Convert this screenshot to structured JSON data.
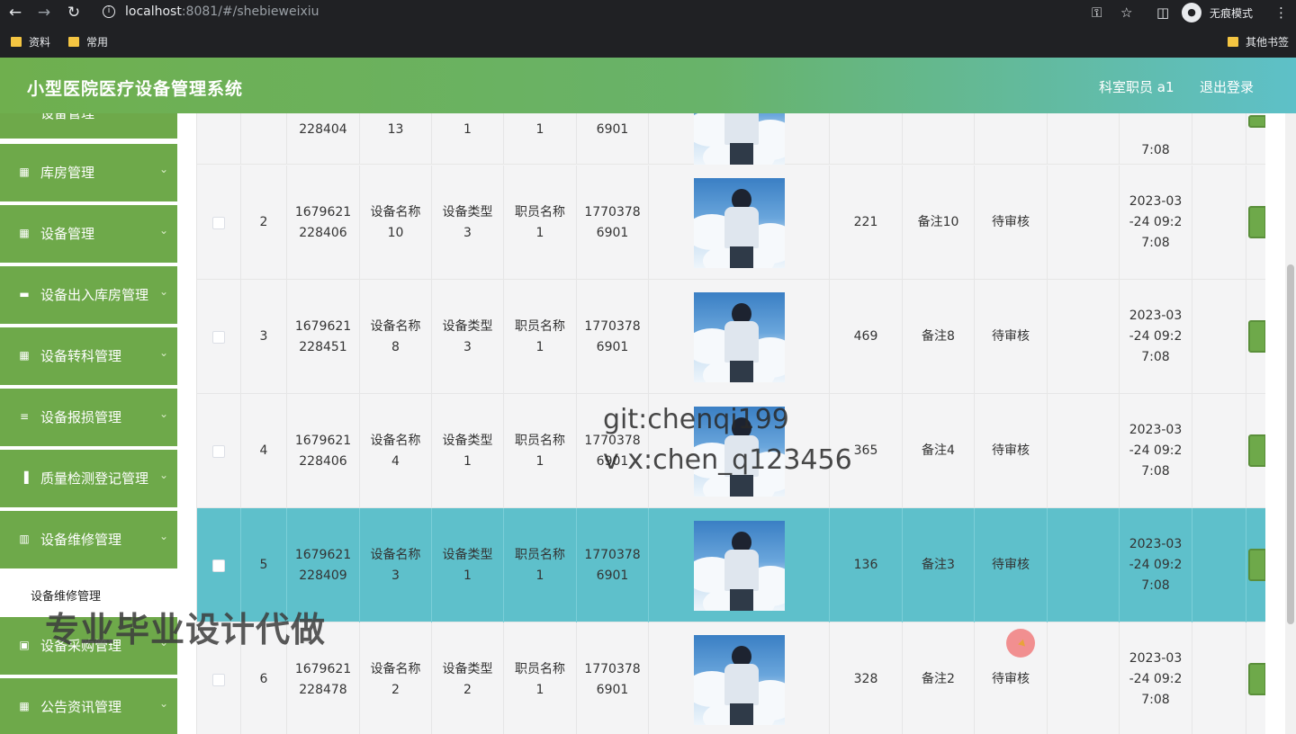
{
  "browser": {
    "url_host": "localhost",
    "url_rest": ":8081/#/shebieweixiu",
    "incognito_label": "无痕模式",
    "bookmarks": [
      "资料",
      "常用"
    ],
    "other_bookmarks": "其他书签"
  },
  "header": {
    "title": "小型医院医疗设备管理系统",
    "user": "科室职员 a1",
    "logout": "退出登录"
  },
  "sidebar": {
    "partial_item": "设备管理",
    "items": [
      {
        "label": "库房管理",
        "icon": "grid-icon"
      },
      {
        "label": "设备管理",
        "icon": "grid-icon"
      },
      {
        "label": "设备出入库房管理",
        "icon": "briefcase-icon"
      },
      {
        "label": "设备转科管理",
        "icon": "grid-icon"
      },
      {
        "label": "设备报损管理",
        "icon": "sliders-icon"
      },
      {
        "label": "质量检测登记管理",
        "icon": "bar-chart-icon"
      },
      {
        "label": "设备维修管理",
        "icon": "book-icon"
      },
      {
        "label": "设备采购管理",
        "icon": "clipboard-icon"
      },
      {
        "label": "公告资讯管理",
        "icon": "grid-icon"
      }
    ],
    "submenu": "设备维修管理"
  },
  "table": {
    "rows": [
      {
        "idx": "",
        "code": "228404",
        "name": "13",
        "type": "1",
        "staff": "1",
        "phone": "6901",
        "qty": "",
        "note": "",
        "status": "",
        "time": "7:08",
        "partial": true
      },
      {
        "idx": "2",
        "code": "1679621\n228406",
        "name": "设备名称\n10",
        "type": "设备类型\n3",
        "staff": "职员名称\n1",
        "phone": "1770378\n6901",
        "qty": "221",
        "note": "备注10",
        "status": "待审核",
        "time": "2023-03\n-24 09:2\n7:08"
      },
      {
        "idx": "3",
        "code": "1679621\n228451",
        "name": "设备名称\n8",
        "type": "设备类型\n3",
        "staff": "职员名称\n1",
        "phone": "1770378\n6901",
        "qty": "469",
        "note": "备注8",
        "status": "待审核",
        "time": "2023-03\n-24 09:2\n7:08"
      },
      {
        "idx": "4",
        "code": "1679621\n228406",
        "name": "设备名称\n4",
        "type": "设备类型\n1",
        "staff": "职员名称\n1",
        "phone": "1770378\n6901",
        "qty": "365",
        "note": "备注4",
        "status": "待审核",
        "time": "2023-03\n-24 09:2\n7:08"
      },
      {
        "idx": "5",
        "code": "1679621\n228409",
        "name": "设备名称\n3",
        "type": "设备类型\n1",
        "staff": "职员名称\n1",
        "phone": "1770378\n6901",
        "qty": "136",
        "note": "备注3",
        "status": "待审核",
        "time": "2023-03\n-24 09:2\n7:08",
        "highlight": true
      },
      {
        "idx": "6",
        "code": "1679621\n228478",
        "name": "设备名称\n2",
        "type": "设备类型\n2",
        "staff": "职员名称\n1",
        "phone": "1770378\n6901",
        "qty": "328",
        "note": "备注2",
        "status": "待审核",
        "time": "2023-03\n-24 09:2\n7:08"
      }
    ]
  },
  "overlay": {
    "watermark_line1": "git:chenqi199",
    "watermark_line2": "v x:chen_q123456",
    "promo": "专业毕业设计代做"
  },
  "colors": {
    "menu_green": "#6ea94a",
    "highlight_row": "#5ec0cb",
    "header_gradient_end": "#5ec0c8"
  }
}
